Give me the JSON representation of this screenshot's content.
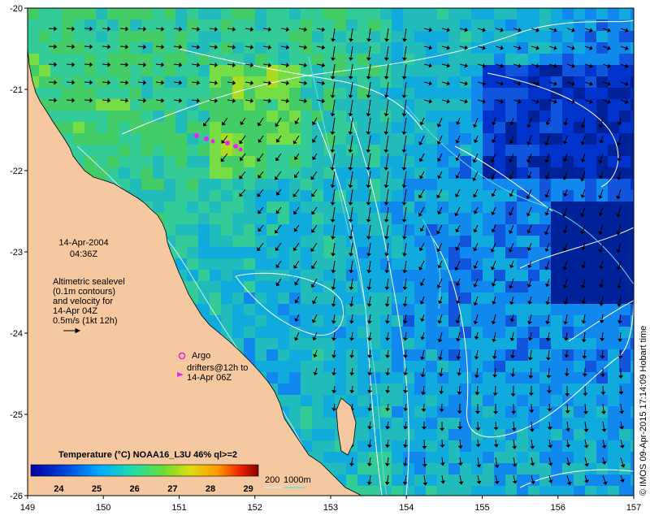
{
  "annotation": {
    "date": "14-Apr-2004",
    "time": "04:36Z",
    "altimetric_lines": [
      "Altimetric sealevel",
      "(0.1m contours)",
      "and velocity for",
      "14-Apr 04Z",
      "0.5m/s (1kt 12h)"
    ]
  },
  "legend": {
    "argo_label": "Argo",
    "drifters_lines": [
      "drifters@12h to",
      "14-Apr 06Z"
    ],
    "colorbar_title": "Temperature (°C) NOAA16_L3U 46% ql>=2",
    "colorbar_ticks": [
      "24",
      "25",
      "26",
      "27",
      "28",
      "29"
    ],
    "depth_labels": [
      "200",
      "1000m"
    ],
    "credit": "© IMOS 09-Apr-2015 17:14:09 Hobart time"
  },
  "axes": {
    "x_ticks": [
      "149",
      "150",
      "151",
      "152",
      "153",
      "154",
      "155",
      "156",
      "157"
    ],
    "y_ticks": [
      "-20",
      "-21",
      "-22",
      "-23",
      "-24",
      "-25",
      "-26"
    ]
  },
  "colors": {
    "land": "#f5c8a0",
    "argo": "#dd22dd",
    "drifter": "#ee22ee",
    "contour": "#ffffff",
    "bathy_200": "#c0eeee",
    "bathy_1000": "#66dddd"
  }
}
